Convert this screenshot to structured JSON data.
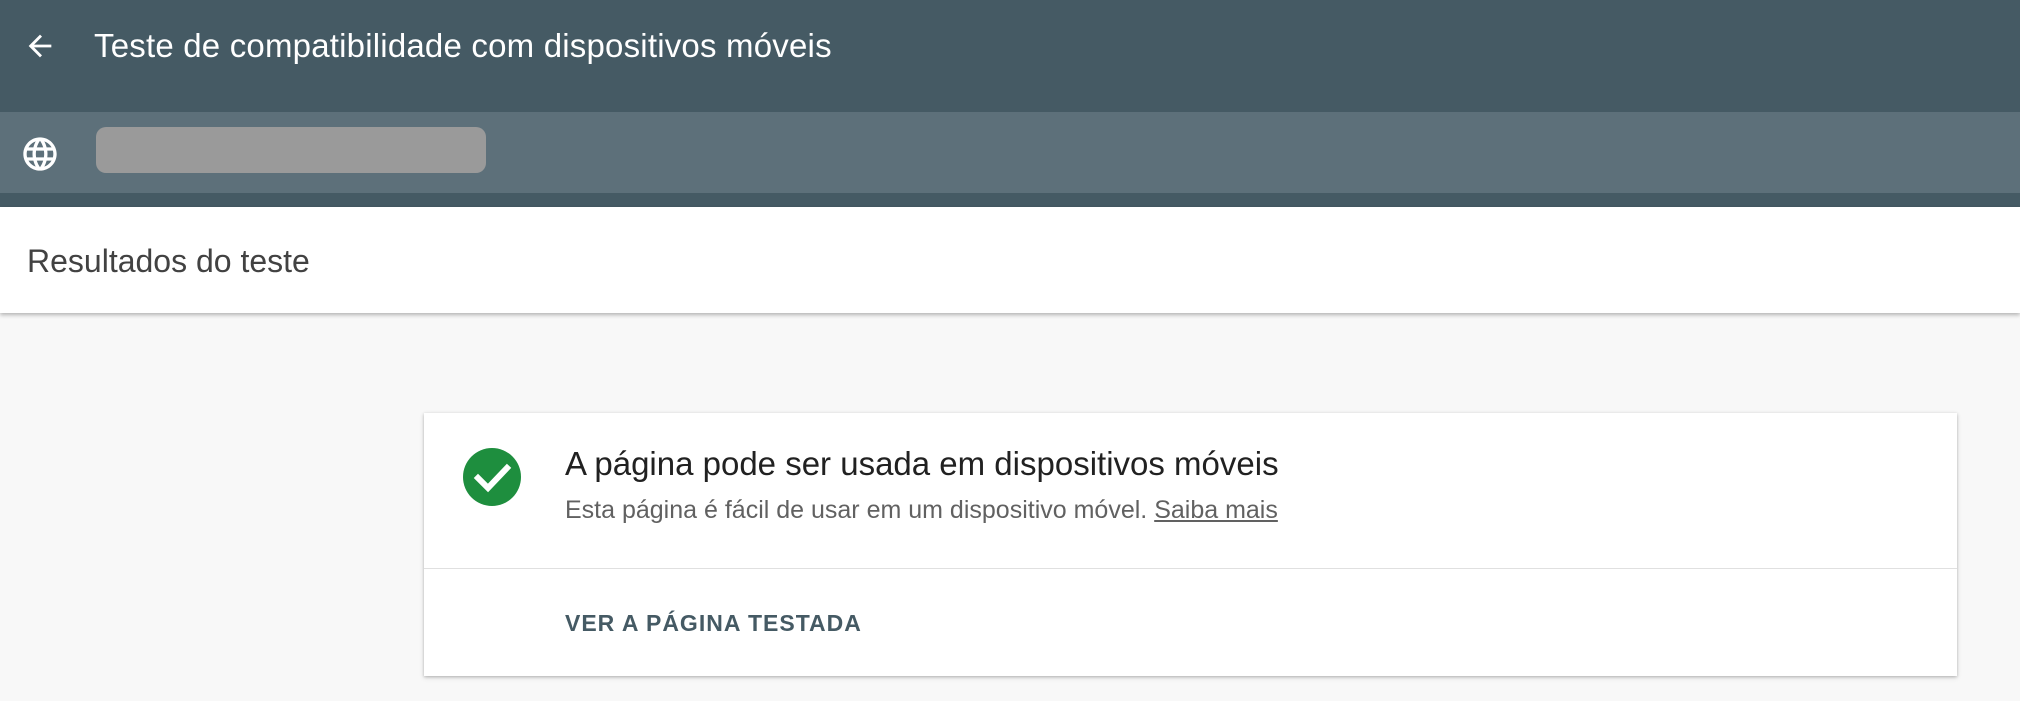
{
  "header": {
    "title": "Teste de compatibilidade com dispositivos móveis",
    "back_icon": "arrow-back-icon"
  },
  "url_bar": {
    "icon": "globe-icon",
    "url_redacted": true
  },
  "results": {
    "title": "Resultados do teste"
  },
  "result_card": {
    "status_icon": "check-circle-icon",
    "status_color": "#1e8e3e",
    "heading": "A página pode ser usada em dispositivos móveis",
    "description": "Esta página é fácil de usar em um dispositivo móvel.",
    "learn_more_label": "Saiba mais",
    "view_tested_page_label": "VER A PÁGINA TESTADA"
  },
  "colors": {
    "header_bg": "#455a64",
    "url_bar_bg": "#5d707a",
    "page_bg": "#f8f8f8",
    "accent_text": "#455a64"
  }
}
